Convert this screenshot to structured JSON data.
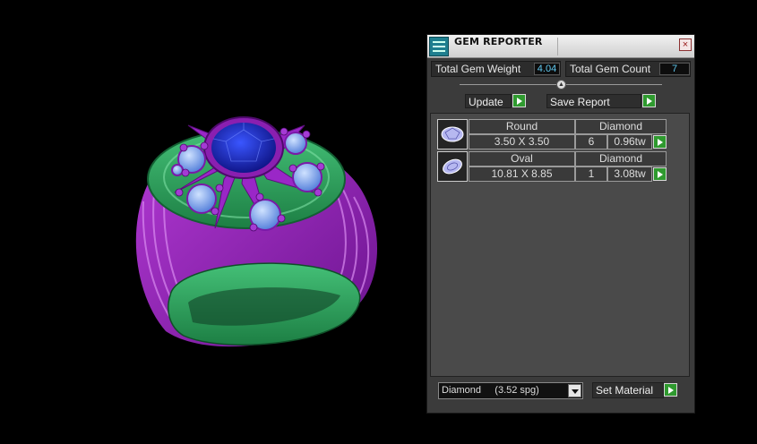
{
  "panel": {
    "title": "GEM REPORTER",
    "close_icon": "×",
    "total_weight_label": "Total Gem Weight",
    "total_weight_value": "4.04",
    "total_count_label": "Total Gem Count",
    "total_count_value": "7",
    "update_label": "Update",
    "save_report_label": "Save Report",
    "gems": [
      {
        "shape": "Round",
        "material": "Diamond",
        "size": "3.50 X 3.50",
        "count": "6",
        "weight": "0.96tw"
      },
      {
        "shape": "Oval",
        "material": "Diamond",
        "size": "10.81 X 8.85",
        "count": "1",
        "weight": "3.08tw"
      }
    ],
    "material_select_value": "Diamond     (3.52 spg)",
    "set_material_label": "Set Material"
  },
  "colors": {
    "ring_metal_purple": "#8a1fb0",
    "ring_band_green": "#2e9e5a",
    "center_stone_blue": "#1e2fb8",
    "side_stone_light_blue": "#6fa0e8",
    "accent_value_cyan": "#60c8ee",
    "arrow_button_green": "#2f9a2f"
  },
  "icons": {
    "app": "gem-reporter-app-icon",
    "gem_round": "round-gem-icon",
    "gem_oval": "oval-gem-icon",
    "arrow": "play-arrow-icon",
    "dropdown": "chevron-down-icon"
  }
}
